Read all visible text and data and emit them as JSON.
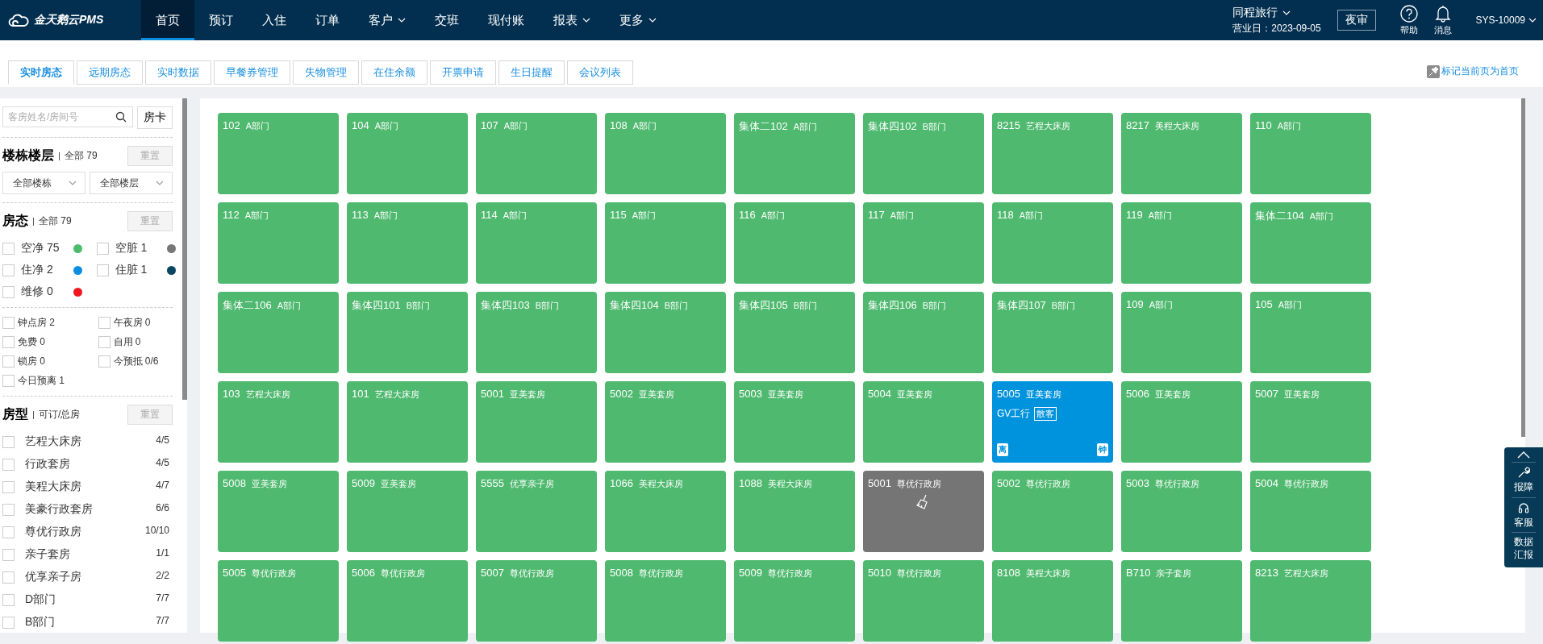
{
  "header": {
    "logo": "金天鹅云PMS",
    "nav": [
      {
        "label": "首页",
        "selected": true,
        "dropdown": false
      },
      {
        "label": "预订",
        "selected": false,
        "dropdown": false
      },
      {
        "label": "入住",
        "selected": false,
        "dropdown": false
      },
      {
        "label": "订单",
        "selected": false,
        "dropdown": false
      },
      {
        "label": "客户",
        "selected": false,
        "dropdown": true
      },
      {
        "label": "交班",
        "selected": false,
        "dropdown": false
      },
      {
        "label": "现付账",
        "selected": false,
        "dropdown": false
      },
      {
        "label": "报表",
        "selected": false,
        "dropdown": true
      },
      {
        "label": "更多",
        "selected": false,
        "dropdown": true
      }
    ],
    "hotel": "同程旅行",
    "business_day": "营业日：2023-09-05",
    "night_audit": "夜审",
    "help": "帮助",
    "messages": "消息",
    "user": "SYS-10009"
  },
  "tabs": [
    {
      "label": "实时房态",
      "selected": true
    },
    {
      "label": "远期房态",
      "selected": false
    },
    {
      "label": "实时数据",
      "selected": false
    },
    {
      "label": "早餐券管理",
      "selected": false
    },
    {
      "label": "失物管理",
      "selected": false
    },
    {
      "label": "在住余额",
      "selected": false
    },
    {
      "label": "开票申请",
      "selected": false
    },
    {
      "label": "生日提醒",
      "selected": false
    },
    {
      "label": "会议列表",
      "selected": false
    }
  ],
  "pin_link": "标记当前页为首页",
  "sidebar": {
    "search": {
      "placeholder": "客房姓名/房间号"
    },
    "room_card_button": "房卡",
    "building": {
      "title": "楼栋楼层",
      "summary": "全部 79",
      "reset": "重置",
      "selects": [
        "全部楼栋",
        "全部楼层"
      ]
    },
    "status": {
      "title": "房态",
      "summary": "全部 79",
      "reset": "重置",
      "items": [
        {
          "label": "空净 75",
          "checked": false,
          "color": "#4cbb6b"
        },
        {
          "label": "空脏 1",
          "checked": false,
          "color": "#777777"
        },
        {
          "label": "住净 2",
          "checked": false,
          "color": "#0a8fe0"
        },
        {
          "label": "住脏 1",
          "checked": false,
          "color": "#0b4660"
        },
        {
          "label": "维修 0",
          "checked": false,
          "color": "#f0151f"
        }
      ]
    },
    "flags": [
      {
        "label": "钟点房 2",
        "checked": false
      },
      {
        "label": "午夜房 0",
        "checked": false
      },
      {
        "label": "免费 0",
        "checked": false
      },
      {
        "label": "自用 0",
        "checked": false
      },
      {
        "label": "锁房 0",
        "checked": false
      },
      {
        "label": "今预抵 0/6",
        "checked": false
      },
      {
        "label": "今日预离 1",
        "checked": false
      }
    ],
    "room_types": {
      "title": "房型",
      "summary": "可订/总房",
      "reset": "重置",
      "items": [
        {
          "name": "艺程大床房",
          "count": "4/5",
          "checked": false
        },
        {
          "name": "行政套房",
          "count": "4/5",
          "checked": false
        },
        {
          "name": "美程大床房",
          "count": "4/7",
          "checked": false
        },
        {
          "name": "美豪行政套房",
          "count": "6/6",
          "checked": false
        },
        {
          "name": "尊优行政房",
          "count": "10/10",
          "checked": false
        },
        {
          "name": "亲子套房",
          "count": "1/1",
          "checked": false
        },
        {
          "name": "优享亲子房",
          "count": "2/2",
          "checked": false
        },
        {
          "name": "D部门",
          "count": "7/7",
          "checked": false
        },
        {
          "name": "B部门",
          "count": "7/7",
          "checked": false
        }
      ]
    }
  },
  "rooms": [
    {
      "number": "102",
      "type": "A部门",
      "kind": "vacant_clean"
    },
    {
      "number": "104",
      "type": "A部门",
      "kind": "vacant_clean"
    },
    {
      "number": "107",
      "type": "A部门",
      "kind": "vacant_clean"
    },
    {
      "number": "108",
      "type": "A部门",
      "kind": "vacant_clean"
    },
    {
      "number": "集体二102",
      "type": "A部门",
      "kind": "vacant_clean"
    },
    {
      "number": "集体四102",
      "type": "B部门",
      "kind": "vacant_clean"
    },
    {
      "number": "8215",
      "type": "艺程大床房",
      "kind": "vacant_clean"
    },
    {
      "number": "8217",
      "type": "美程大床房",
      "kind": "vacant_clean"
    },
    {
      "number": "110",
      "type": "A部门",
      "kind": "vacant_clean"
    },
    {
      "number": "112",
      "type": "A部门",
      "kind": "vacant_clean"
    },
    {
      "number": "113",
      "type": "A部门",
      "kind": "vacant_clean"
    },
    {
      "number": "114",
      "type": "A部门",
      "kind": "vacant_clean"
    },
    {
      "number": "115",
      "type": "A部门",
      "kind": "vacant_clean"
    },
    {
      "number": "116",
      "type": "A部门",
      "kind": "vacant_clean"
    },
    {
      "number": "117",
      "type": "A部门",
      "kind": "vacant_clean"
    },
    {
      "number": "118",
      "type": "A部门",
      "kind": "vacant_clean"
    },
    {
      "number": "119",
      "type": "A部门",
      "kind": "vacant_clean"
    },
    {
      "number": "集体二104",
      "type": "A部门",
      "kind": "vacant_clean"
    },
    {
      "number": "集体二106",
      "type": "A部门",
      "kind": "vacant_clean"
    },
    {
      "number": "集体四101",
      "type": "B部门",
      "kind": "vacant_clean"
    },
    {
      "number": "集体四103",
      "type": "B部门",
      "kind": "vacant_clean"
    },
    {
      "number": "集体四104",
      "type": "B部门",
      "kind": "vacant_clean"
    },
    {
      "number": "集体四105",
      "type": "B部门",
      "kind": "vacant_clean"
    },
    {
      "number": "集体四106",
      "type": "B部门",
      "kind": "vacant_clean"
    },
    {
      "number": "集体四107",
      "type": "B部门",
      "kind": "vacant_clean"
    },
    {
      "number": "109",
      "type": "A部门",
      "kind": "vacant_clean"
    },
    {
      "number": "105",
      "type": "A部门",
      "kind": "vacant_clean"
    },
    {
      "number": "103",
      "type": "艺程大床房",
      "kind": "vacant_clean"
    },
    {
      "number": "101",
      "type": "艺程大床房",
      "kind": "vacant_clean"
    },
    {
      "number": "5001",
      "type": "亚美套房",
      "kind": "vacant_clean"
    },
    {
      "number": "5002",
      "type": "亚美套房",
      "kind": "vacant_clean"
    },
    {
      "number": "5003",
      "type": "亚美套房",
      "kind": "vacant_clean"
    },
    {
      "number": "5004",
      "type": "亚美套房",
      "kind": "vacant_clean"
    },
    {
      "number": "5005",
      "type": "亚美套房",
      "kind": "occupied_clean",
      "guest": "GV工行",
      "guest_tag": "散客",
      "badges": [
        "离",
        "钟"
      ]
    },
    {
      "number": "5006",
      "type": "亚美套房",
      "kind": "vacant_clean"
    },
    {
      "number": "5007",
      "type": "亚美套房",
      "kind": "vacant_clean"
    },
    {
      "number": "5008",
      "type": "亚美套房",
      "kind": "vacant_clean"
    },
    {
      "number": "5009",
      "type": "亚美套房",
      "kind": "vacant_clean"
    },
    {
      "number": "5555",
      "type": "优享亲子房",
      "kind": "vacant_clean"
    },
    {
      "number": "1066",
      "type": "美程大床房",
      "kind": "vacant_clean"
    },
    {
      "number": "1088",
      "type": "美程大床房",
      "kind": "vacant_clean"
    },
    {
      "number": "5001",
      "type": "尊优行政房",
      "kind": "vacant_dirty"
    },
    {
      "number": "5002",
      "type": "尊优行政房",
      "kind": "vacant_clean"
    },
    {
      "number": "5003",
      "type": "尊优行政房",
      "kind": "vacant_clean"
    },
    {
      "number": "5004",
      "type": "尊优行政房",
      "kind": "vacant_clean"
    },
    {
      "number": "5005",
      "type": "尊优行政房",
      "kind": "vacant_clean"
    },
    {
      "number": "5006",
      "type": "尊优行政房",
      "kind": "vacant_clean"
    },
    {
      "number": "5007",
      "type": "尊优行政房",
      "kind": "vacant_clean"
    },
    {
      "number": "5008",
      "type": "尊优行政房",
      "kind": "vacant_clean"
    },
    {
      "number": "5009",
      "type": "尊优行政房",
      "kind": "vacant_clean"
    },
    {
      "number": "5010",
      "type": "尊优行政房",
      "kind": "vacant_clean"
    },
    {
      "number": "8108",
      "type": "美程大床房",
      "kind": "vacant_clean"
    },
    {
      "number": "B710",
      "type": "亲子套房",
      "kind": "vacant_clean"
    },
    {
      "number": "8213",
      "type": "艺程大床房",
      "kind": "vacant_clean"
    }
  ],
  "float_panel": {
    "items": [
      {
        "kind": "report_issue",
        "label": "报障"
      },
      {
        "kind": "support",
        "label": "客服"
      },
      {
        "kind": "data",
        "label": "数据汇报"
      }
    ]
  }
}
